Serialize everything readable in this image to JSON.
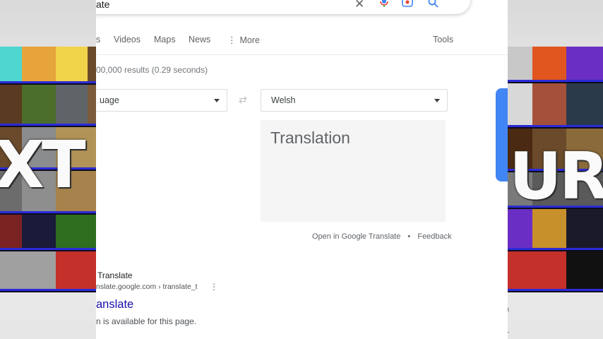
{
  "search": {
    "query": "ate",
    "clear_icon": "close-icon",
    "mic_icon": "microphone-icon",
    "lens_icon": "camera-lens-icon",
    "search_icon": "search-icon"
  },
  "tabs": {
    "partial": "s",
    "videos": "Videos",
    "maps": "Maps",
    "news": "News",
    "more": "More",
    "more_icon": "vertical-dots-icon",
    "tools": "Tools"
  },
  "stats": "00,000 results (0.29 seconds)",
  "translator": {
    "source_language": "uage",
    "target_language": "Welsh",
    "swap_icon": "swap-arrows-icon",
    "output_placeholder": "Translation",
    "open_link": "Open in Google Translate",
    "separator": "•",
    "feedback": "Feedback"
  },
  "result": {
    "site_name": "Translate",
    "url": "nslate.google.com › translate_t",
    "title": "anslate",
    "snippet": "n is available for this page."
  },
  "overlay": {
    "left_text": "XT",
    "right_text": "UR",
    "right_small_a": "a",
    "right_small_l": "L"
  },
  "colors": {
    "link_title": "#1a0dab",
    "tile_border": "#2b2bd8",
    "accent_blue": "#4285f4"
  }
}
